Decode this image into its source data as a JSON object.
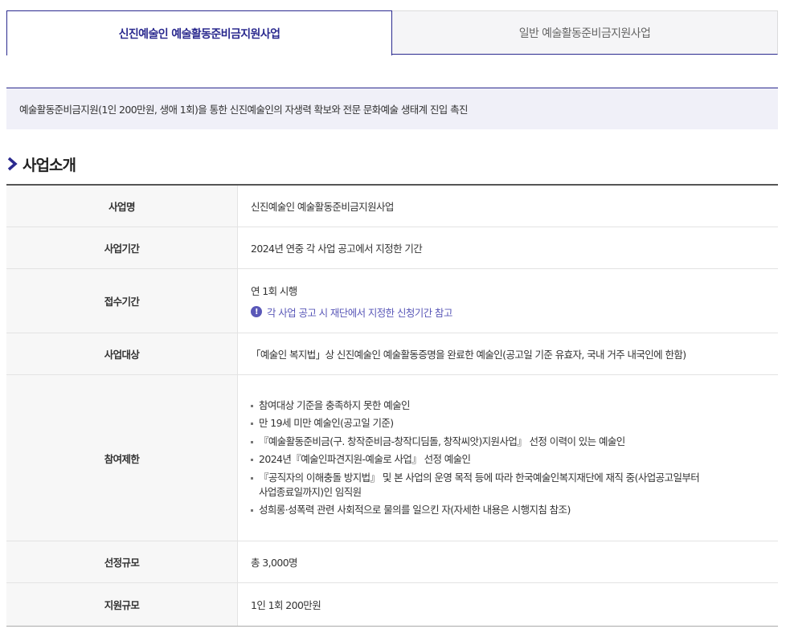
{
  "tabs": [
    {
      "label": "신진예술인 예술활동준비금지원사업",
      "active": true
    },
    {
      "label": "일반 예술활동준비금지원사업",
      "active": false
    }
  ],
  "banner": {
    "text": "예술활동준비금지원(1인 200만원, 생애 1회)을 통한 신진예술인의 자생력 확보와 전문 문화예술 생태계 진입 촉진"
  },
  "section": {
    "title": "사업소개",
    "icon": "chevron-right-icon"
  },
  "table": {
    "business_name": {
      "label": "사업명",
      "value": "신진예술인 예술활동준비금지원사업"
    },
    "business_period": {
      "label": "사업기간",
      "value": "2024년 연중 각 사업 공고에서 지정한 기간"
    },
    "application_period": {
      "label": "접수기간",
      "value": "연 1회 시행",
      "notice": "각 사업 공고 시 재단에서 지정한 신청기간 참고",
      "notice_icon": "!"
    },
    "target": {
      "label": "사업대상",
      "value": "「예술인 복지법」상 신진예술인 예술활동증명을 완료한 예술인(공고일 기준 유효자, 국내 거주 내국인에 한함)"
    },
    "restrictions": {
      "label": "참여제한",
      "items": [
        "참여대상 기준을 충족하지 못한 예술인",
        "만 19세 미만 예술인(공고일 기준)",
        "『예술활동준비금(구. 창작준비금-창작디딤돌, 창작씨앗)지원사업』 선정 이력이 있는 예술인",
        "2024년『예술인파견지원-예술로 사업』 선정 예술인",
        "『공직자의 이해충돌 방지법』 및 본 사업의 운영 목적 등에 따라 한국예술인복지재단에 재직 중(사업공고일부터",
        "사업종료일까지)인 임직원",
        "성희롱·성폭력 관련 사회적으로 물의를 일으킨 자(자세한 내용은 시행지침 참조)"
      ]
    },
    "selection_scale": {
      "label": "선정규모",
      "value": "총 3,000명"
    },
    "support_scale": {
      "label": "지원규모",
      "value": "1인 1회 200만원"
    }
  },
  "colors": {
    "accent": "#2b2a8f",
    "banner_bg": "#f0f0f8",
    "notice": "#5a58b8"
  }
}
